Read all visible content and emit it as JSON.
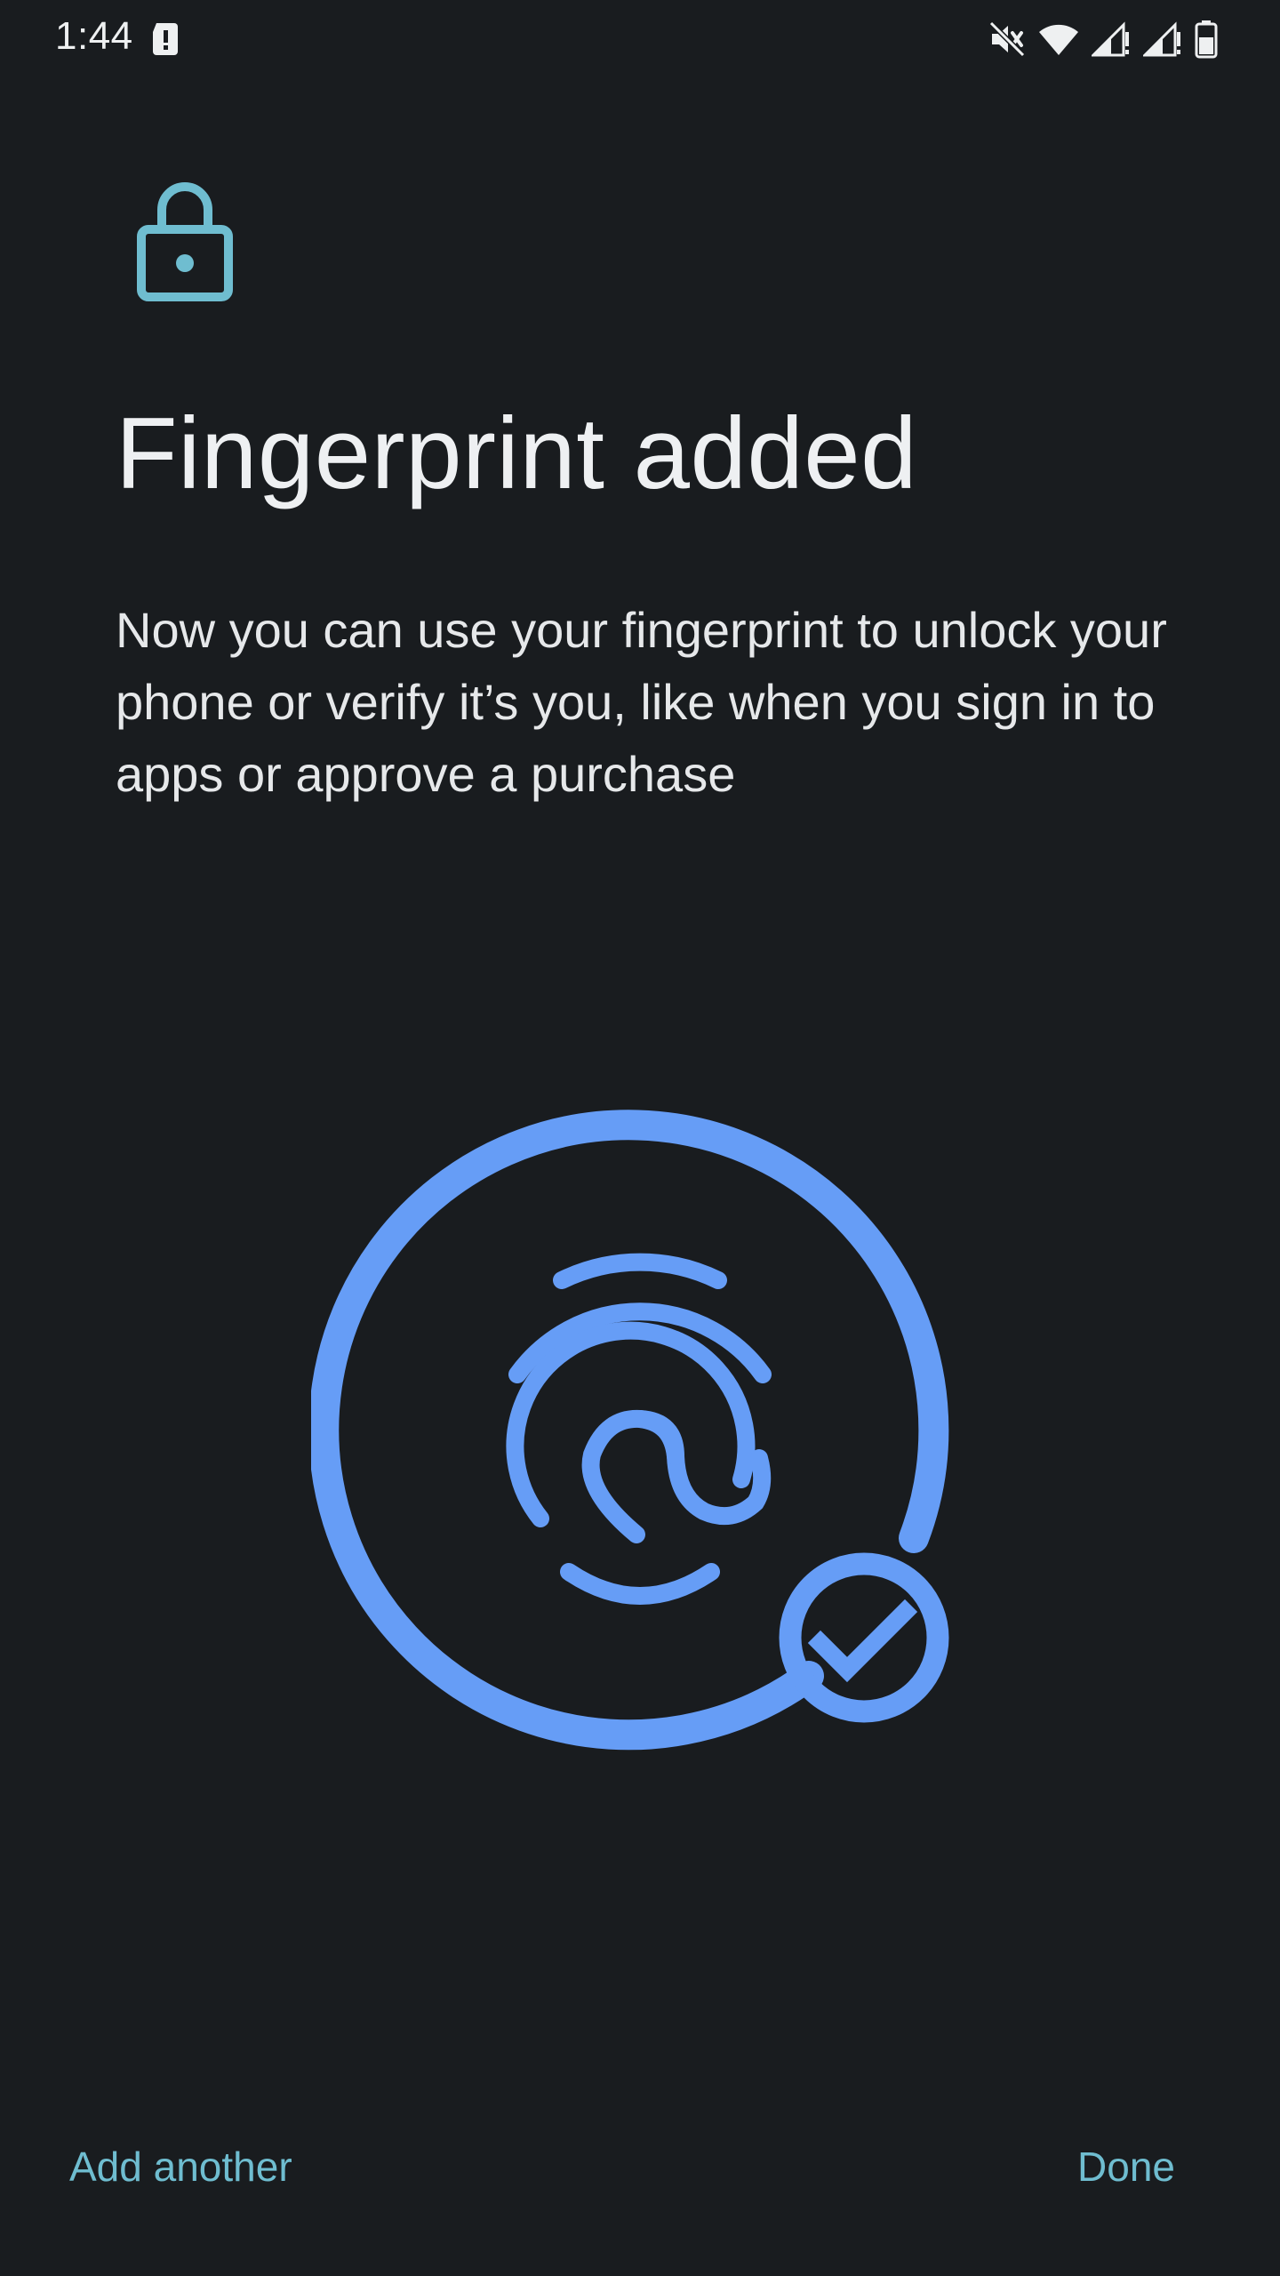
{
  "status_bar": {
    "time": "1:44",
    "icons": [
      "alert-icon",
      "mute-icon",
      "wifi-icon",
      "signal-icon",
      "signal-icon",
      "battery-icon"
    ]
  },
  "header": {
    "icon": "lock-icon",
    "title": "Fingerprint added"
  },
  "body": {
    "description": "Now you can use your fingerprint to unlock your phone or verify it’s you, like when you sign in to apps or approve a purchase"
  },
  "illustration": {
    "icon": "fingerprint-success-icon",
    "accent_color": "#669df6"
  },
  "actions": {
    "add_another_label": "Add another",
    "done_label": "Done"
  },
  "colors": {
    "background": "#191c1f",
    "text": "#e6e8ea",
    "accent_teal": "#6fbdd0",
    "accent_blue": "#669df6"
  }
}
